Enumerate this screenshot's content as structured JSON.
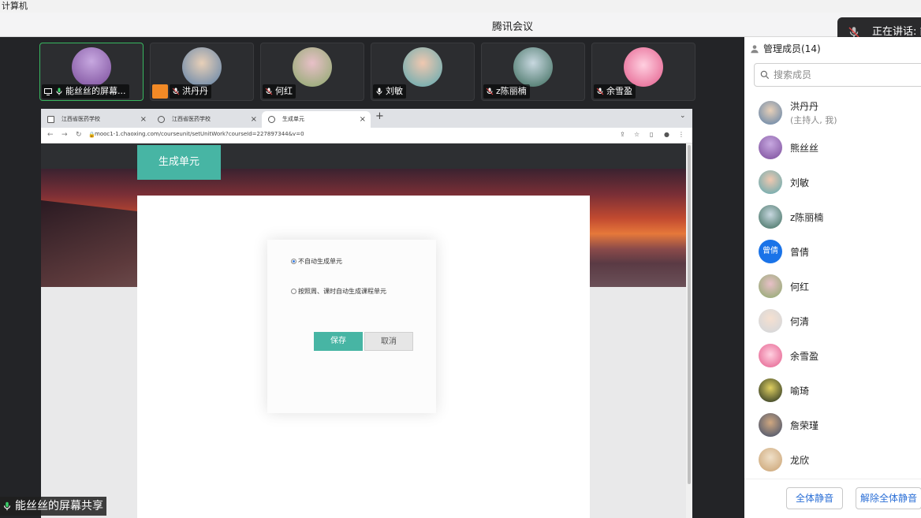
{
  "os": {
    "label": "计算机"
  },
  "window": {
    "title": "腾讯会议"
  },
  "speaking": {
    "label": "正在讲话: 能"
  },
  "tiles": [
    {
      "name": "能丝丝的屏幕...",
      "color": "#8a5fa8"
    },
    {
      "name": "洪丹丹",
      "color": "#5a7fa8"
    },
    {
      "name": "何红",
      "color": "#9aa86a"
    },
    {
      "name": "刘敏",
      "color": "#5aa8b0"
    },
    {
      "name": "z陈丽楠",
      "color": "#3a6a5a"
    },
    {
      "name": "余雪盈",
      "color": "#e35a8a"
    }
  ],
  "browser": {
    "tabs": [
      {
        "label": "江西省医药学校"
      },
      {
        "label": "江西省医药学校"
      },
      {
        "label": "生成单元"
      }
    ],
    "url": "mooc1-1.chaoxing.com/courseunit/setUnitWork?courseId=227897344&v=0"
  },
  "page": {
    "generate_label": "生成单元",
    "option_none": "不自动生成单元",
    "option_auto": "按照周、课时自动生成课程单元",
    "save": "保存",
    "cancel": "取消"
  },
  "share_label": "能丝丝的屏幕共享",
  "sidebar": {
    "title": "管理成员(14)",
    "search_placeholder": "搜索成员",
    "members": [
      {
        "name": "洪丹丹",
        "sub": "(主持人, 我)",
        "color": "#5a7fa8"
      },
      {
        "name": "熊丝丝",
        "color": "#8a5fa8"
      },
      {
        "name": "刘敏",
        "color": "#5aa8b0"
      },
      {
        "name": "z陈丽楠",
        "color": "#3a6a5a"
      },
      {
        "name": "曾倩",
        "initials": "曾倩",
        "color": "#1a73e8"
      },
      {
        "name": "何红",
        "color": "#9aa86a"
      },
      {
        "name": "何清",
        "color": "#cfd6dc"
      },
      {
        "name": "余雪盈",
        "color": "#e35a8a"
      },
      {
        "name": "喻琦",
        "color": "#1e2a1e"
      },
      {
        "name": "詹荣瑾",
        "color": "#3a4a6a"
      },
      {
        "name": "龙欣",
        "color": "#c8a070"
      }
    ],
    "mute_all": "全体静音",
    "unmute_all": "解除全体静音"
  }
}
